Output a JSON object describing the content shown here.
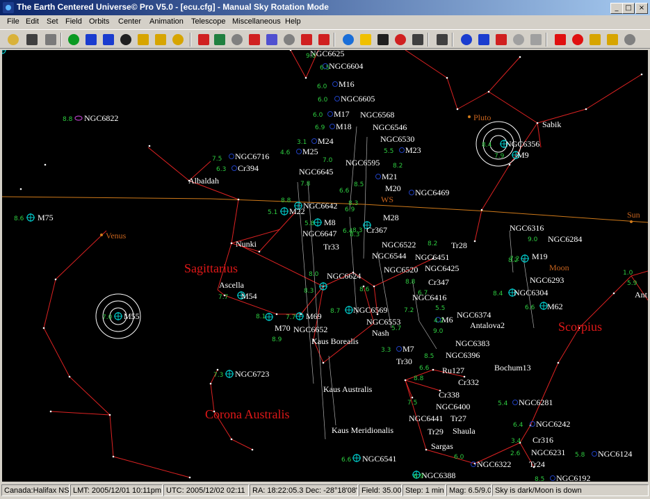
{
  "window": {
    "title": "The Earth Centered Universe© Pro V5.0 - [ecu.cfg] - Manual Sky Rotation Mode"
  },
  "menu": [
    "File",
    "Edit",
    "Set",
    "Field",
    "Orbits",
    "Center",
    "Animation",
    "Telescope",
    "Miscellaneous",
    "Help"
  ],
  "toolbar": [
    {
      "name": "open-folder-icon",
      "color": "#d9b23a"
    },
    {
      "name": "save-disk-icon",
      "color": "#404040"
    },
    {
      "name": "printer-icon",
      "color": "#7a7a7a"
    },
    {
      "name": "undo-arrow-icon",
      "color": "#0a9a22"
    },
    {
      "name": "zoom-out-icon",
      "color": "#1a3ccf"
    },
    {
      "name": "zoom-in-icon",
      "color": "#1a3ccf"
    },
    {
      "name": "north-up-icon",
      "color": "#202020"
    },
    {
      "name": "south-icon",
      "color": "#d7a500"
    },
    {
      "name": "east-icon",
      "color": "#d7a500"
    },
    {
      "name": "west-icon",
      "color": "#d7a500"
    },
    {
      "name": "stars-icon",
      "color": "#d02020"
    },
    {
      "name": "galaxy-icon",
      "color": "#208040"
    },
    {
      "name": "nebula-icon",
      "color": "#808080"
    },
    {
      "name": "starburst-icon",
      "color": "#d02020"
    },
    {
      "name": "constellation-icon",
      "color": "#5050d0"
    },
    {
      "name": "grid-icon",
      "color": "#808080"
    },
    {
      "name": "lines-icon",
      "color": "#d02020"
    },
    {
      "name": "labels-abc-icon",
      "color": "#d02020"
    },
    {
      "name": "earth-globe-icon",
      "color": "#1a6ed8"
    },
    {
      "name": "sun-icon",
      "color": "#f0c000"
    },
    {
      "name": "dec-scale-icon",
      "color": "#202020"
    },
    {
      "name": "ra-scale-icon",
      "color": "#d02020"
    },
    {
      "name": "find-magnifier-icon",
      "color": "#404040"
    },
    {
      "name": "telescope-icon",
      "color": "#404040"
    },
    {
      "name": "target-circles-icon",
      "color": "#1a3ccf"
    },
    {
      "name": "reticle-icon",
      "color": "#1a3ccf"
    },
    {
      "name": "marker-up-icon",
      "color": "#d02020"
    },
    {
      "name": "horizon-h-icon",
      "color": "#a0a0a0"
    },
    {
      "name": "vertical-v-icon",
      "color": "#a0a0a0"
    },
    {
      "name": "arrow-up-icon",
      "color": "#e01010"
    },
    {
      "name": "arrow-down-icon",
      "color": "#e01010"
    },
    {
      "name": "walk-left-icon",
      "color": "#d7a500"
    },
    {
      "name": "walk-right-icon",
      "color": "#d7a500"
    },
    {
      "name": "lightning-icon",
      "color": "#808080"
    }
  ],
  "colors": {
    "line": "#dd2222",
    "star": "#ffffff",
    "dso": "#00c8c8",
    "dso_mag": "#2ecc40",
    "ecliptic": "#d07a1a",
    "planet": "#c8641e",
    "constellation": "#e01818",
    "label": "#ffffff"
  },
  "sky": {
    "constellations": [
      {
        "name": "Sagittarius"
      },
      {
        "name": "Scorpius"
      },
      {
        "name": "Corona Australis"
      }
    ],
    "planets": [
      {
        "name": "Pluto"
      },
      {
        "name": "Venus"
      },
      {
        "name": "Sun"
      },
      {
        "name": "Moon"
      },
      {
        "name": "WS"
      }
    ],
    "stars": [
      {
        "name": "Sabik"
      },
      {
        "name": "Albaldah"
      },
      {
        "name": "Nunki"
      },
      {
        "name": "Ascella"
      },
      {
        "name": "Kaus Borealis"
      },
      {
        "name": "Nash"
      },
      {
        "name": "Kaus Australis"
      },
      {
        "name": "Kaus Meridionalis"
      },
      {
        "name": "Sargas"
      },
      {
        "name": "Shaula"
      },
      {
        "name": "Tr33"
      },
      {
        "name": "Tr28"
      },
      {
        "name": "Tr30"
      },
      {
        "name": "Tr27"
      },
      {
        "name": "Tr29"
      },
      {
        "name": "Tr24"
      },
      {
        "name": "Antalova2"
      },
      {
        "name": "Bochum13"
      },
      {
        "name": "Ant"
      }
    ],
    "dsos": [
      {
        "name": "NGC6625",
        "mag": "9.0"
      },
      {
        "name": "NGC6604",
        "mag": "6.5"
      },
      {
        "name": "M16",
        "mag": "6.0"
      },
      {
        "name": "NGC6605",
        "mag": "6.0"
      },
      {
        "name": "NGC6822",
        "mag": "8.8"
      },
      {
        "name": "M17",
        "mag": "6.0"
      },
      {
        "name": "NGC6568",
        "mag": ""
      },
      {
        "name": "M18",
        "mag": "6.9"
      },
      {
        "name": "NGC6546",
        "mag": ""
      },
      {
        "name": "M24",
        "mag": "3.1"
      },
      {
        "name": "NGC6530",
        "mag": ""
      },
      {
        "name": "M25",
        "mag": "4.6"
      },
      {
        "name": "M23",
        "mag": "5.5"
      },
      {
        "name": "NGC6716",
        "mag": "7.5"
      },
      {
        "name": "Cr394",
        "mag": "6.3"
      },
      {
        "name": "NGC6645",
        "mag": "8.5"
      },
      {
        "name": "NGC6595",
        "mag": "7.0"
      },
      {
        "name": "M21",
        "mag": "5.9"
      },
      {
        "name": "M20",
        "mag": "6.3"
      },
      {
        "name": "NGC6469",
        "mag": "8.2"
      },
      {
        "name": "NGC6356",
        "mag": "8.4"
      },
      {
        "name": "M9",
        "mag": "7.9"
      },
      {
        "name": "M75",
        "mag": "8.6"
      },
      {
        "name": "NGC6642",
        "mag": "8.8"
      },
      {
        "name": "M22",
        "mag": "5.1"
      },
      {
        "name": "M8",
        "mag": "5.8"
      },
      {
        "name": "M28",
        "mag": "6.9"
      },
      {
        "name": "Cr367",
        "mag": "6.4"
      },
      {
        "name": "NGC6647",
        "mag": ""
      },
      {
        "name": "NGC6316",
        "mag": ""
      },
      {
        "name": "NGC6284",
        "mag": "9.0"
      },
      {
        "name": "NGC6522",
        "mag": "8.3"
      },
      {
        "name": "NGC6451",
        "mag": "8.2"
      },
      {
        "name": "NGC6544",
        "mag": ""
      },
      {
        "name": "NGC6425",
        "mag": "7.7"
      },
      {
        "name": "NGC6520",
        "mag": "7.6"
      },
      {
        "name": "M19",
        "mag": "7.2"
      },
      {
        "name": "NGC6293",
        "mag": "8.2"
      },
      {
        "name": "NGC6624",
        "mag": "8.3"
      },
      {
        "name": "Cr347",
        "mag": "8.8"
      },
      {
        "name": "NGC6304",
        "mag": "8.4"
      },
      {
        "name": "M54",
        "mag": "7.7"
      },
      {
        "name": "NGC6416",
        "mag": "5.7"
      },
      {
        "name": "M62",
        "mag": "6.6"
      },
      {
        "name": "NGC6569",
        "mag": "8.7"
      },
      {
        "name": "NGC6374",
        "mag": "5.5"
      },
      {
        "name": "M55",
        "mag": "7.0"
      },
      {
        "name": "M69",
        "mag": "7.7"
      },
      {
        "name": "M70",
        "mag": "8.1"
      },
      {
        "name": "NGC6652",
        "mag": "8.9"
      },
      {
        "name": "NGC6553",
        "mag": "8.6"
      },
      {
        "name": "M6",
        "mag": "4.2"
      },
      {
        "name": "NGC6383",
        "mag": "9.0"
      },
      {
        "name": "NGC6396",
        "mag": "8.5"
      },
      {
        "name": "M7",
        "mag": "3.3"
      },
      {
        "name": "NGC6723",
        "mag": "7.3"
      },
      {
        "name": "Ru127",
        "mag": "6.6"
      },
      {
        "name": "Cr332",
        "mag": "7.2"
      },
      {
        "name": "Cr338",
        "mag": "7.4"
      },
      {
        "name": "NGC6400",
        "mag": "8.8"
      },
      {
        "name": "NGC6441",
        "mag": "7.5"
      },
      {
        "name": "NGC6281",
        "mag": "5.4"
      },
      {
        "name": "NGC6242",
        "mag": "6.4"
      },
      {
        "name": "Cr316",
        "mag": "3.4"
      },
      {
        "name": "NGC6231",
        "mag": "2.6"
      },
      {
        "name": "NGC6124",
        "mag": "5.8"
      },
      {
        "name": "NGC6541",
        "mag": "6.6"
      },
      {
        "name": "NGC6322",
        "mag": "6.0"
      },
      {
        "name": "NGC6388",
        "mag": "6.9"
      },
      {
        "name": "NGC6192",
        "mag": "8.5"
      },
      {
        "name": "",
        "mag": "1.0"
      },
      {
        "name": "",
        "mag": "5.9"
      },
      {
        "name": "",
        "mag": "7.8"
      },
      {
        "name": "",
        "mag": "6.6"
      },
      {
        "name": "",
        "mag": "8.5"
      },
      {
        "name": "",
        "mag": "8.3"
      },
      {
        "name": "",
        "mag": "8.3"
      },
      {
        "name": "",
        "mag": "7.2"
      },
      {
        "name": "",
        "mag": "9.0"
      },
      {
        "name": "",
        "mag": "6.7"
      },
      {
        "name": "",
        "mag": "8.6"
      },
      {
        "name": "",
        "mag": "8.0"
      }
    ]
  },
  "status": [
    "Canada:Halifax NS",
    "LMT: 2005/12/01 10:11pm",
    "UTC: 2005/12/02 02:11",
    "RA: 18:22:05.3 Dec: -28°18'08\"",
    "Field: 35.00°",
    "Step: 1 min",
    "Mag: 6.5/9.0",
    "Sky is dark/Moon is down"
  ]
}
